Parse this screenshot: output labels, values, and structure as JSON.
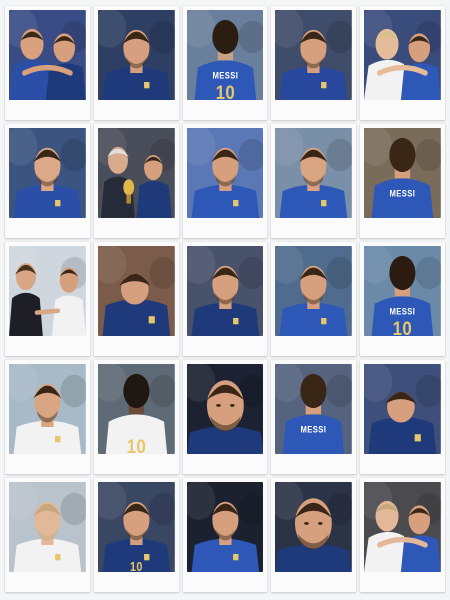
{
  "collage": {
    "photos": [
      {
        "bg": "#3a4c86",
        "jersey": "#2b4fa6",
        "skin": "#d9a07d",
        "hair": "#3a2818",
        "text": "",
        "kind": "hug"
      },
      {
        "bg": "#2e3f63",
        "jersey": "#1f3a7a",
        "skin": "#d6a080",
        "hair": "#3b2716",
        "text": "",
        "kind": "portrait"
      },
      {
        "bg": "#6a7f9b",
        "jersey": "#2d58b8",
        "skin": "#caa084",
        "hair": "#2c1d12",
        "text": "MESSI",
        "num": "10",
        "kind": "back"
      },
      {
        "bg": "#3f4d6a",
        "jersey": "#27489c",
        "skin": "#d6a07e",
        "hair": "#3a2616",
        "text": "",
        "kind": "portrait"
      },
      {
        "bg": "#3a4c7c",
        "jersey": "#f2f2f2",
        "skin": "#e6bb9a",
        "hair": "#d8c08c",
        "text": "",
        "kind": "hug2"
      },
      {
        "bg": "#3b5480",
        "jersey": "#2b4fa6",
        "skin": "#dca888",
        "hair": "#3a2616",
        "text": "",
        "kind": "portrait"
      },
      {
        "bg": "#4a4d5a",
        "jersey": "#262b3a",
        "skin": "#d9aa8c",
        "hair": "#e0e0e0",
        "text": "",
        "kind": "trophy"
      },
      {
        "bg": "#5b78b6",
        "jersey": "#2d58b8",
        "skin": "#d6a07e",
        "hair": "#3a2616",
        "text": "",
        "kind": "portrait"
      },
      {
        "bg": "#7a8fa8",
        "jersey": "#2d58b8",
        "skin": "#d8a482",
        "hair": "#3a2616",
        "text": "",
        "kind": "portrait"
      },
      {
        "bg": "#7a6c5b",
        "jersey": "#2d58b8",
        "skin": "#d6a07e",
        "hair": "#3a2616",
        "text": "MESSI",
        "num": "",
        "kind": "back"
      },
      {
        "bg": "#cfd6dd",
        "jersey": "#1e1f26",
        "skin": "#d8a684",
        "hair": "#4a3020",
        "text": "",
        "kind": "handshake"
      },
      {
        "bg": "#7b5c4a",
        "jersey": "#1f3a7a",
        "skin": "#d6a07e",
        "hair": "#3a2616",
        "text": "",
        "kind": "down"
      },
      {
        "bg": "#48526b",
        "jersey": "#1f3a7a",
        "skin": "#d6a07e",
        "hair": "#3a2616",
        "text": "",
        "kind": "portrait"
      },
      {
        "bg": "#4f6b8e",
        "jersey": "#2d58b8",
        "skin": "#d6a07e",
        "hair": "#3a2616",
        "text": "",
        "kind": "portrait"
      },
      {
        "bg": "#6a8aa8",
        "jersey": "#2d58b8",
        "skin": "#d6a07e",
        "hair": "#2b1b10",
        "text": "MESSI",
        "num": "10",
        "kind": "back"
      },
      {
        "bg": "#a8bac7",
        "jersey": "#f2f2f2",
        "skin": "#d9a684",
        "hair": "#3a2616",
        "text": "",
        "kind": "portrait"
      },
      {
        "bg": "#5e6a76",
        "jersey": "#f2f2f2",
        "skin": "#6a4a38",
        "hair": "#1f1812",
        "text": "",
        "num": "10",
        "kind": "back"
      },
      {
        "bg": "#1d2232",
        "jersey": "#1f3a7a",
        "skin": "#d6a07e",
        "hair": "#3a2616",
        "text": "",
        "kind": "closeup"
      },
      {
        "bg": "#55637f",
        "jersey": "#2d58b8",
        "skin": "#d6a07e",
        "hair": "#3a2616",
        "text": "MESSI",
        "num": "",
        "kind": "back"
      },
      {
        "bg": "#3d4f7a",
        "jersey": "#1f3a7a",
        "skin": "#d6a07e",
        "hair": "#3a2616",
        "text": "",
        "kind": "down"
      },
      {
        "bg": "#b9c3cc",
        "jersey": "#f2f2f2",
        "skin": "#e2b898",
        "hair": "#c7a87a",
        "text": "",
        "kind": "portrait"
      },
      {
        "bg": "#3a4763",
        "jersey": "#1f3a7a",
        "skin": "#d6a07e",
        "hair": "#3a2616",
        "text": "",
        "num": "10",
        "kind": "portrait"
      },
      {
        "bg": "#1c2130",
        "jersey": "#2d58b8",
        "skin": "#d6a07e",
        "hair": "#3a2616",
        "text": "",
        "kind": "portrait"
      },
      {
        "bg": "#2b3347",
        "jersey": "#1f3a7a",
        "skin": "#d6a07e",
        "hair": "#3a2616",
        "text": "",
        "kind": "closeup"
      },
      {
        "bg": "#4a4a4f",
        "jersey": "#f2f2f2",
        "skin": "#e2b898",
        "hair": "#c7a87a",
        "text": "",
        "kind": "hug2"
      }
    ]
  }
}
